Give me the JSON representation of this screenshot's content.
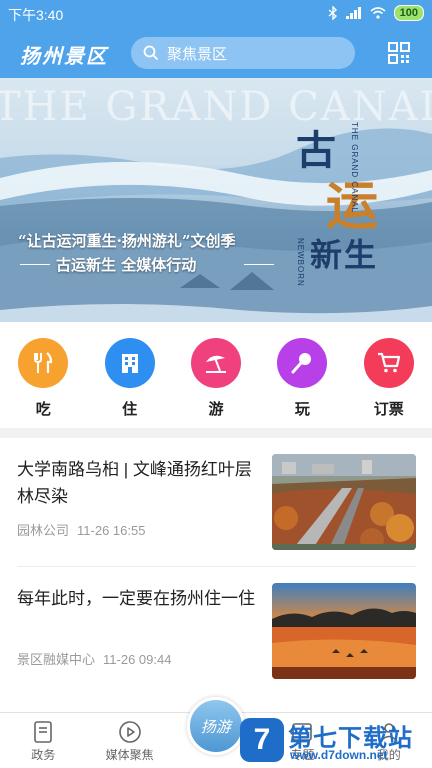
{
  "status_bar": {
    "time": "下午3:40",
    "battery": "100"
  },
  "header": {
    "title": "扬州景区",
    "search_placeholder": "聚焦景区",
    "search_icon": "search-icon",
    "scan_icon": "qr-scan-icon"
  },
  "banner": {
    "english_title": "THE GRAND CANAL",
    "slogan_line1": "“让古运河重生·扬州游礼”文创季",
    "slogan_line2": "古运新生 全媒体行动",
    "big_char1": "古",
    "big_char2": "运",
    "big_char3": "新生",
    "vertical1": "THE GRAND CANAL",
    "vertical2": "NEWBORN"
  },
  "categories": [
    {
      "label": "吃",
      "icon": "utensils-icon",
      "color": "#f7a22f"
    },
    {
      "label": "住",
      "icon": "building-icon",
      "color": "#2e8ff0"
    },
    {
      "label": "游",
      "icon": "beach-umbrella-icon",
      "color": "#f0407d"
    },
    {
      "label": "玩",
      "icon": "microphone-icon",
      "color": "#b840e8"
    },
    {
      "label": "订票",
      "icon": "shopping-cart-icon",
      "color": "#f23c5a"
    }
  ],
  "news": [
    {
      "title": "大学南路乌桕 | 文峰通扬红叶层林尽染",
      "source": "园林公司",
      "time": "11-26 16:55"
    },
    {
      "title": "每年此时，一定要在扬州住一住",
      "source": "景区融媒中心",
      "time": "11-26 09:44"
    }
  ],
  "tabs": [
    {
      "label": "政务",
      "icon": "document-icon"
    },
    {
      "label": "媒体聚焦",
      "icon": "play-icon"
    },
    {
      "label": "",
      "icon": "center-logo-icon",
      "badge_text": "扬游"
    },
    {
      "label": "专题",
      "icon": "topic-icon"
    },
    {
      "label": "我的",
      "icon": "user-icon"
    }
  ],
  "watermark": {
    "mark": "7",
    "name": "第七下载站",
    "url": "www.d7down.net"
  }
}
